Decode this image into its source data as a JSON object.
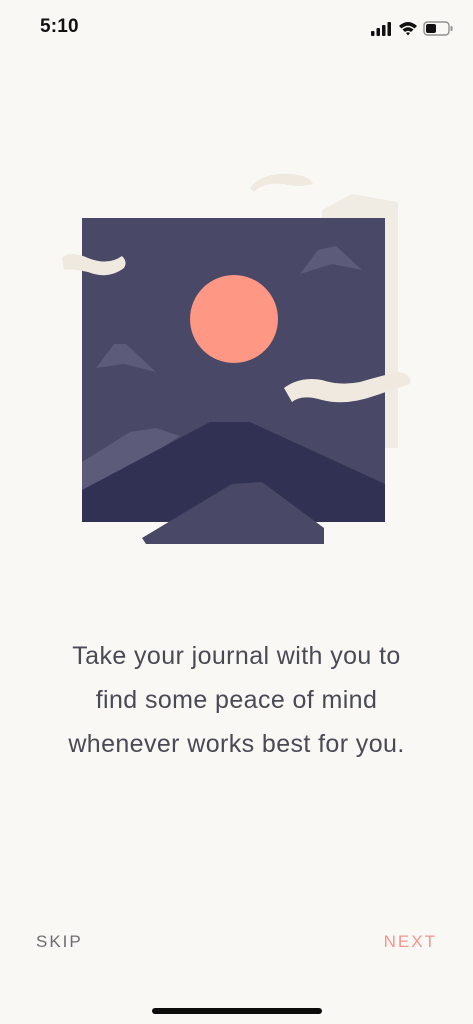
{
  "status_bar": {
    "time": "5:10"
  },
  "icons": {
    "signal": "cellular-signal-icon",
    "wifi": "wifi-icon",
    "battery": "battery-icon"
  },
  "onboarding": {
    "message": "Take your journal with you to\nfind some peace of mind\nwhenever works best for you."
  },
  "navigation": {
    "skip_label": "SKIP",
    "next_label": "NEXT"
  },
  "colors": {
    "background": "#f9f8f5",
    "accent": "#f6958b",
    "sky": "#494866",
    "sun": "#fe9784",
    "mountain_dark": "#303153",
    "paper": "#efe9df"
  }
}
